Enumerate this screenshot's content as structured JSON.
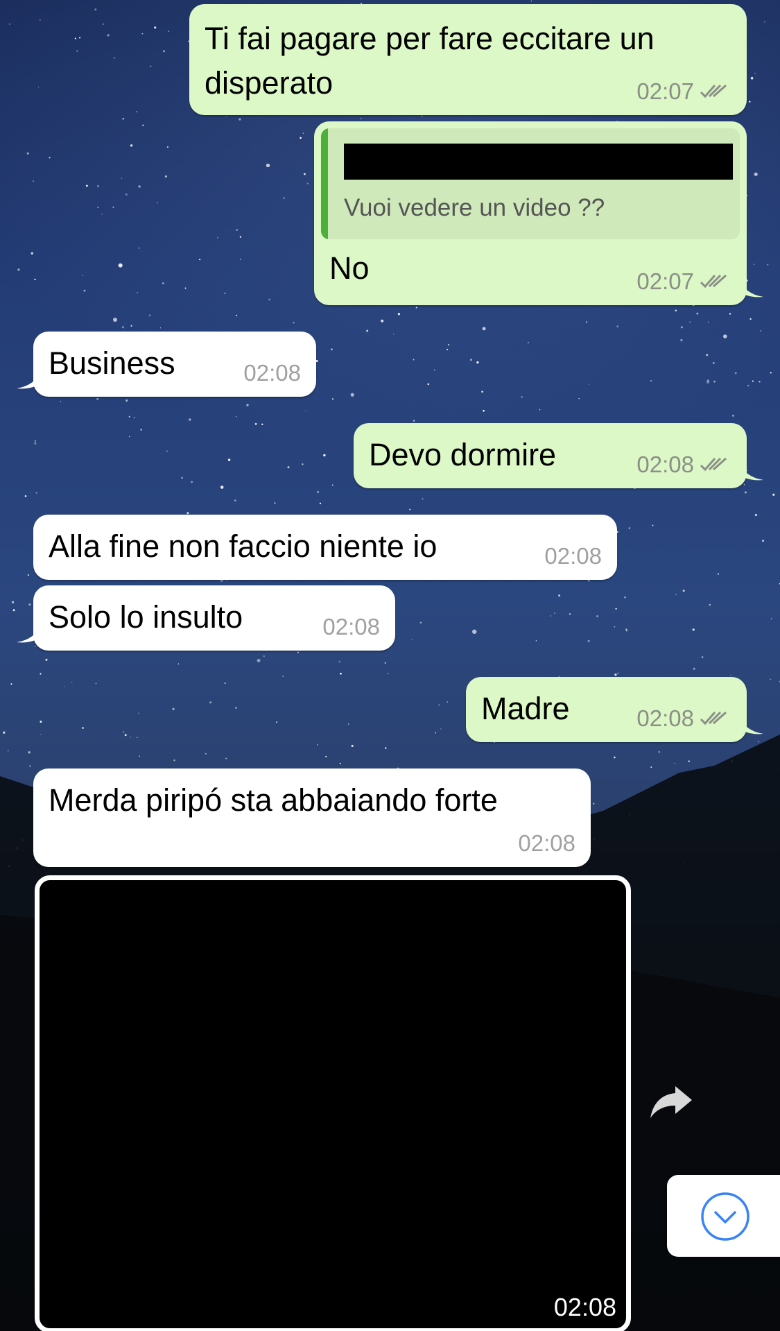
{
  "colors": {
    "outgoing_bubble": "#dcf8c6",
    "incoming_bubble": "#ffffff",
    "reply_bar": "#4caf3a",
    "scroll_button_accent": "#3a83f7"
  },
  "messages": [
    {
      "direction": "out",
      "text": "Ti fai pagare per fare eccitare un disperato",
      "time": "02:07",
      "status_icon": "double-check-icon"
    },
    {
      "direction": "out",
      "reply_quote": {
        "text": "Vuoi vedere un video ??"
      },
      "text": "No",
      "time": "02:07",
      "status_icon": "double-check-icon"
    },
    {
      "direction": "in",
      "text": "Business",
      "time": "02:08"
    },
    {
      "direction": "out",
      "text": "Devo dormire",
      "time": "02:08",
      "status_icon": "double-check-icon"
    },
    {
      "direction": "in",
      "text": "Alla fine non faccio niente io",
      "time": "02:08"
    },
    {
      "direction": "in",
      "text": "Solo lo insulto",
      "time": "02:08"
    },
    {
      "direction": "out",
      "text": "Madre",
      "time": "02:08",
      "status_icon": "double-check-icon"
    },
    {
      "direction": "in",
      "text": "Merda piripó sta abbaiando forte",
      "time": "02:08"
    },
    {
      "direction": "in",
      "type": "media",
      "time": "02:08"
    }
  ],
  "icons": {
    "forward": "forward-arrow-icon",
    "scroll_down": "chevron-down-circle-icon"
  }
}
